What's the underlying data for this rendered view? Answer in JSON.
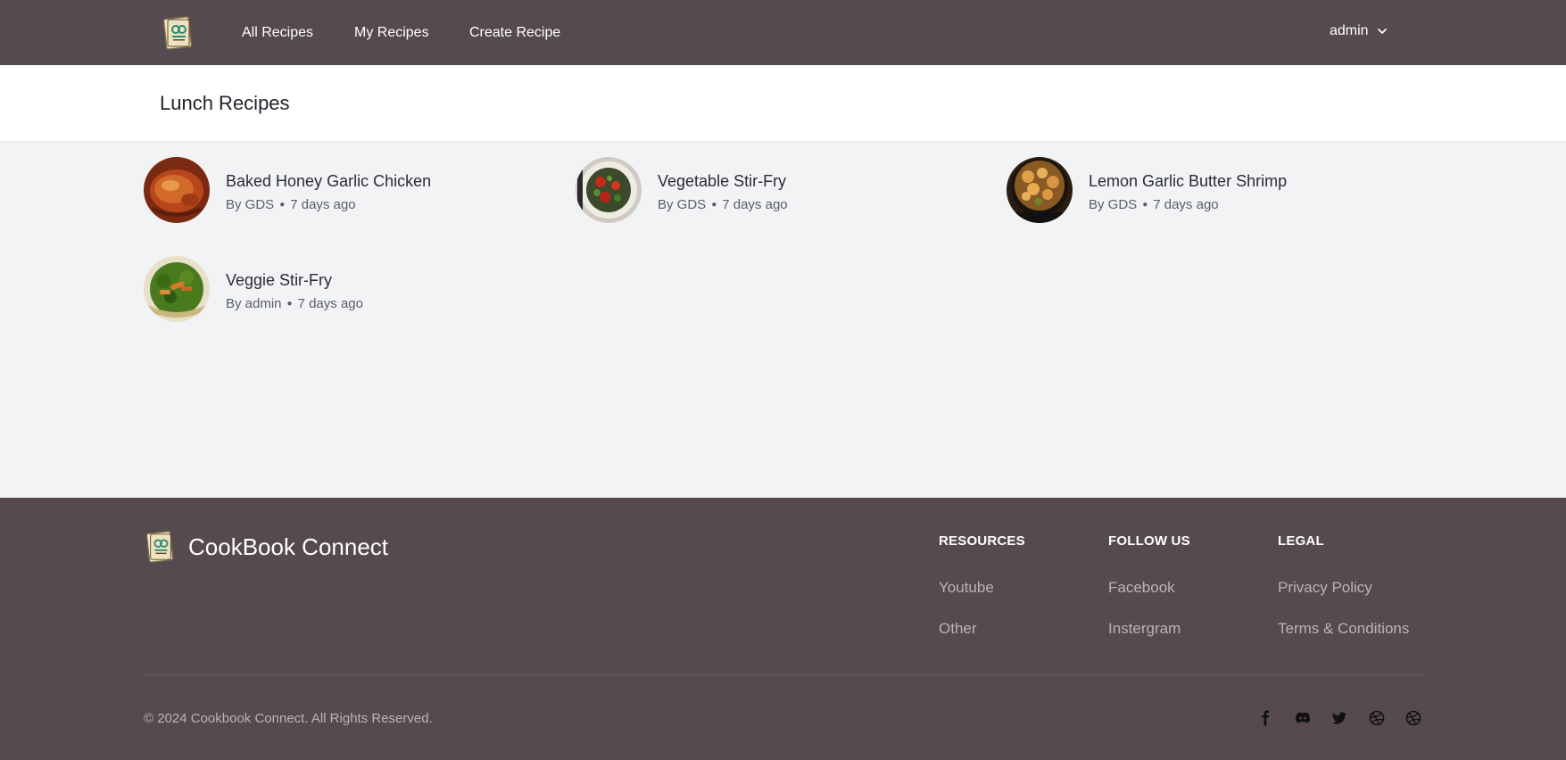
{
  "nav": {
    "logo_icon": "cookbook-logo-icon",
    "links": [
      "All Recipes",
      "My Recipes",
      "Create Recipe"
    ],
    "user": "admin",
    "user_menu_icon": "chevron-down-icon"
  },
  "page": {
    "title": "Lunch Recipes"
  },
  "recipes": [
    {
      "title": "Baked Honey Garlic Chicken",
      "author": "By GDS",
      "time": "7 days ago",
      "image_icon": "roast-chicken-image"
    },
    {
      "title": "Vegetable Stir-Fry",
      "author": "By GDS",
      "time": "7 days ago",
      "image_icon": "stir-fry-bowl-image"
    },
    {
      "title": "Lemon Garlic Butter Shrimp",
      "author": "By GDS",
      "time": "7 days ago",
      "image_icon": "shrimp-pan-image"
    },
    {
      "title": "Veggie Stir-Fry",
      "author": "By admin",
      "time": "7 days ago",
      "image_icon": "broccoli-stir-fry-image"
    }
  ],
  "footer": {
    "brand": "CookBook Connect",
    "columns": [
      {
        "title": "RESOURCES",
        "links": [
          "Youtube",
          "Other"
        ]
      },
      {
        "title": "FOLLOW US",
        "links": [
          "Facebook",
          "Instergram"
        ]
      },
      {
        "title": "LEGAL",
        "links": [
          "Privacy Policy",
          "Terms & Conditions"
        ]
      }
    ],
    "copyright": "© 2024 Cookbook Connect. All Rights Reserved.",
    "social_icons": [
      "facebook-icon",
      "discord-icon",
      "twitter-icon",
      "dribbble-icon",
      "dribbble-icon"
    ]
  },
  "colors": {
    "nav_bg": "#544a50",
    "page_bg": "#f2f3f5",
    "footer_link": "#b9b4b8"
  }
}
